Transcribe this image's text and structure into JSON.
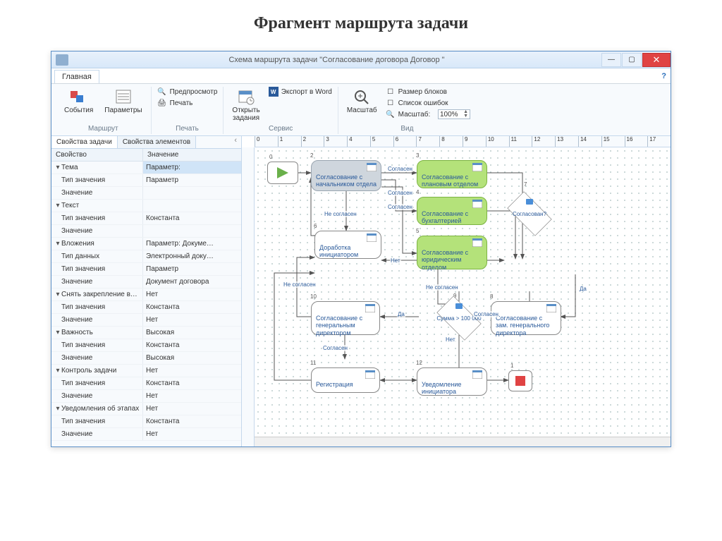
{
  "pageTitle": "Фрагмент маршрута задачи",
  "window": {
    "title": "Схема маршрута задачи \"Согласование договора Договор \""
  },
  "ribbon": {
    "tab": "Главная",
    "groups": {
      "route": {
        "label": "Маршрут",
        "events": "События",
        "params": "Параметры"
      },
      "print": {
        "label": "Печать",
        "preview": "Предпросмотр",
        "print": "Печать"
      },
      "service": {
        "label": "Сервис",
        "open": "Открыть\nзадания",
        "export": "Экспорт в Word"
      },
      "view": {
        "label": "Вид",
        "zoom": "Масштаб",
        "blocksize": "Размер блоков",
        "errors": "Список ошибок",
        "zoomLabel": "Масштаб:",
        "zoomValue": "100%"
      }
    }
  },
  "side": {
    "tabs": {
      "task": "Свойства задачи",
      "elements": "Свойства элементов"
    },
    "head": {
      "prop": "Свойство",
      "val": "Значение"
    },
    "rows": [
      {
        "g": true,
        "p": "Тема",
        "v": "Параметр:",
        "sel": true
      },
      {
        "p": "Тип значения",
        "v": "Параметр"
      },
      {
        "p": "Значение",
        "v": ""
      },
      {
        "g": true,
        "p": "Текст",
        "v": ""
      },
      {
        "p": "Тип значения",
        "v": "Константа"
      },
      {
        "p": "Значение",
        "v": ""
      },
      {
        "g": true,
        "p": "Вложения",
        "v": "Параметр: Докуме…"
      },
      {
        "p": "Тип данных",
        "v": "Электронный доку…"
      },
      {
        "p": "Тип значения",
        "v": "Параметр"
      },
      {
        "p": "Значение",
        "v": "Документ договора"
      },
      {
        "g": true,
        "p": "Снять закрепление вло…",
        "v": "Нет"
      },
      {
        "p": "Тип значения",
        "v": "Константа"
      },
      {
        "p": "Значение",
        "v": "Нет"
      },
      {
        "g": true,
        "p": "Важность",
        "v": "Высокая"
      },
      {
        "p": "Тип значения",
        "v": "Константа"
      },
      {
        "p": "Значение",
        "v": "Высокая"
      },
      {
        "g": true,
        "p": "Контроль задачи",
        "v": "Нет"
      },
      {
        "p": "Тип значения",
        "v": "Константа"
      },
      {
        "p": "Значение",
        "v": "Нет"
      },
      {
        "g": true,
        "p": "Уведомления об этапах",
        "v": "Нет"
      },
      {
        "p": "Тип значения",
        "v": "Константа"
      },
      {
        "p": "Значение",
        "v": "Нет"
      }
    ]
  },
  "ruler": [
    "0",
    "1",
    "2",
    "3",
    "4",
    "5",
    "6",
    "7",
    "8",
    "9",
    "10",
    "11",
    "12",
    "13",
    "14",
    "15",
    "16",
    "17"
  ],
  "flow": {
    "nodes": {
      "n2": {
        "idx": "2",
        "text": "Согласование с начальником отдела"
      },
      "n3": {
        "idx": "3",
        "text": "Согласование с плановым отделом"
      },
      "n4": {
        "idx": "4",
        "text": "Согласование с бухгалтерией"
      },
      "n5": {
        "idx": "5",
        "text": "Согласование с юридическим отделом"
      },
      "n6": {
        "idx": "6",
        "text": "Доработка инициатором"
      },
      "n7": {
        "idx": "7",
        "text": "Согласован?"
      },
      "n8": {
        "idx": "8",
        "text": "Согласование с зам. генерального директора"
      },
      "n9": {
        "idx": "9",
        "text": "Сумма > 100 000"
      },
      "n10": {
        "idx": "10",
        "text": "Согласование с генеральным директором"
      },
      "n11": {
        "idx": "11",
        "text": "Регистрация"
      },
      "n12": {
        "idx": "12",
        "text": "Уведомление инициатора"
      },
      "end": {
        "idx": "1"
      },
      "start": {
        "idx": "0"
      }
    },
    "labels": {
      "agreed": "Согласен",
      "notAgreed": "Не согласен",
      "yes": "Да",
      "no": "Нет"
    }
  }
}
